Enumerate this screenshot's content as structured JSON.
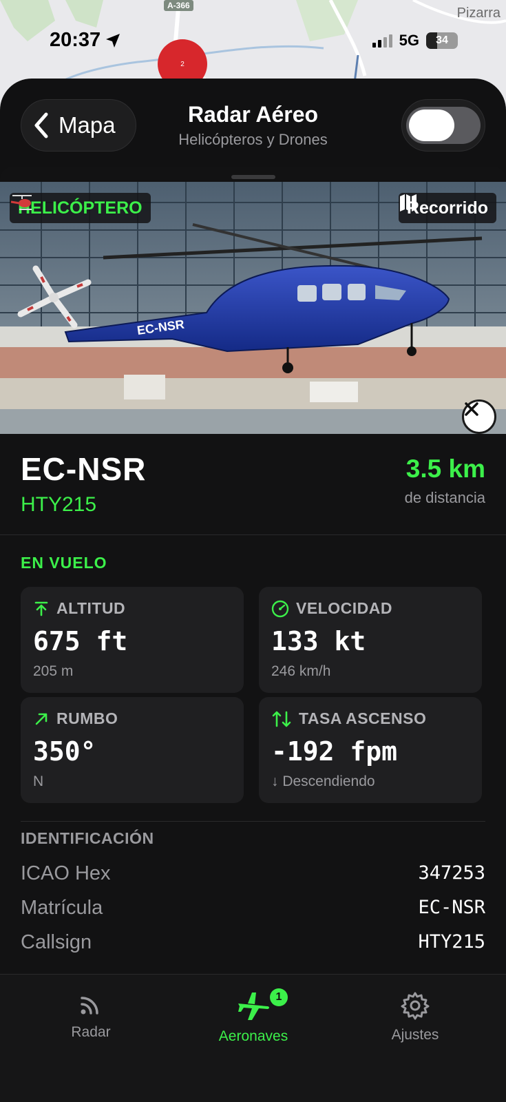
{
  "map": {
    "road_label": "A-366",
    "place_label": "Pizarra",
    "cluster_count": "2"
  },
  "status_bar": {
    "time": "20:37",
    "network": "5G",
    "battery": "34"
  },
  "nav": {
    "back_label": "Mapa",
    "title": "Radar Aéreo",
    "subtitle": "Helicópteros y Drones",
    "toggle_on": false
  },
  "photo": {
    "type_label": "HELICÓPTERO",
    "track_label": "Recorrido",
    "aircraft_tail_text": "EC-NSR"
  },
  "aircraft": {
    "registration": "EC-NSR",
    "callsign": "HTY215",
    "distance": "3.5 km",
    "distance_caption": "de distancia",
    "status": "EN VUELO"
  },
  "stats": [
    {
      "label": "ALTITUD",
      "icon": "arrow-up-icon",
      "value": "675 ft",
      "sub": "205 m"
    },
    {
      "label": "VELOCIDAD",
      "icon": "speedometer-icon",
      "value": "133 kt",
      "sub": "246 km/h"
    },
    {
      "label": "RUMBO",
      "icon": "arrow-up-right-icon",
      "value": "350°",
      "sub": "N"
    },
    {
      "label": "TASA ASCENSO",
      "icon": "arrows-up-down-icon",
      "value": "-192 fpm",
      "sub": "↓ Descendiendo"
    }
  ],
  "identification": {
    "title": "IDENTIFICACIÓN",
    "rows": [
      {
        "key": "ICAO Hex",
        "value": "347253"
      },
      {
        "key": "Matrícula",
        "value": "EC-NSR"
      },
      {
        "key": "Callsign",
        "value": "HTY215"
      }
    ]
  },
  "tabs": [
    {
      "label": "Radar",
      "icon": "radar-signal-icon",
      "active": false
    },
    {
      "label": "Aeronaves",
      "icon": "airplane-icon",
      "active": true,
      "badge": "1"
    },
    {
      "label": "Ajustes",
      "icon": "gear-icon",
      "active": false
    }
  ],
  "colors": {
    "accent": "#3cf04a",
    "background": "#111112",
    "card": "#1f1f21",
    "cluster": "#d7272c"
  }
}
